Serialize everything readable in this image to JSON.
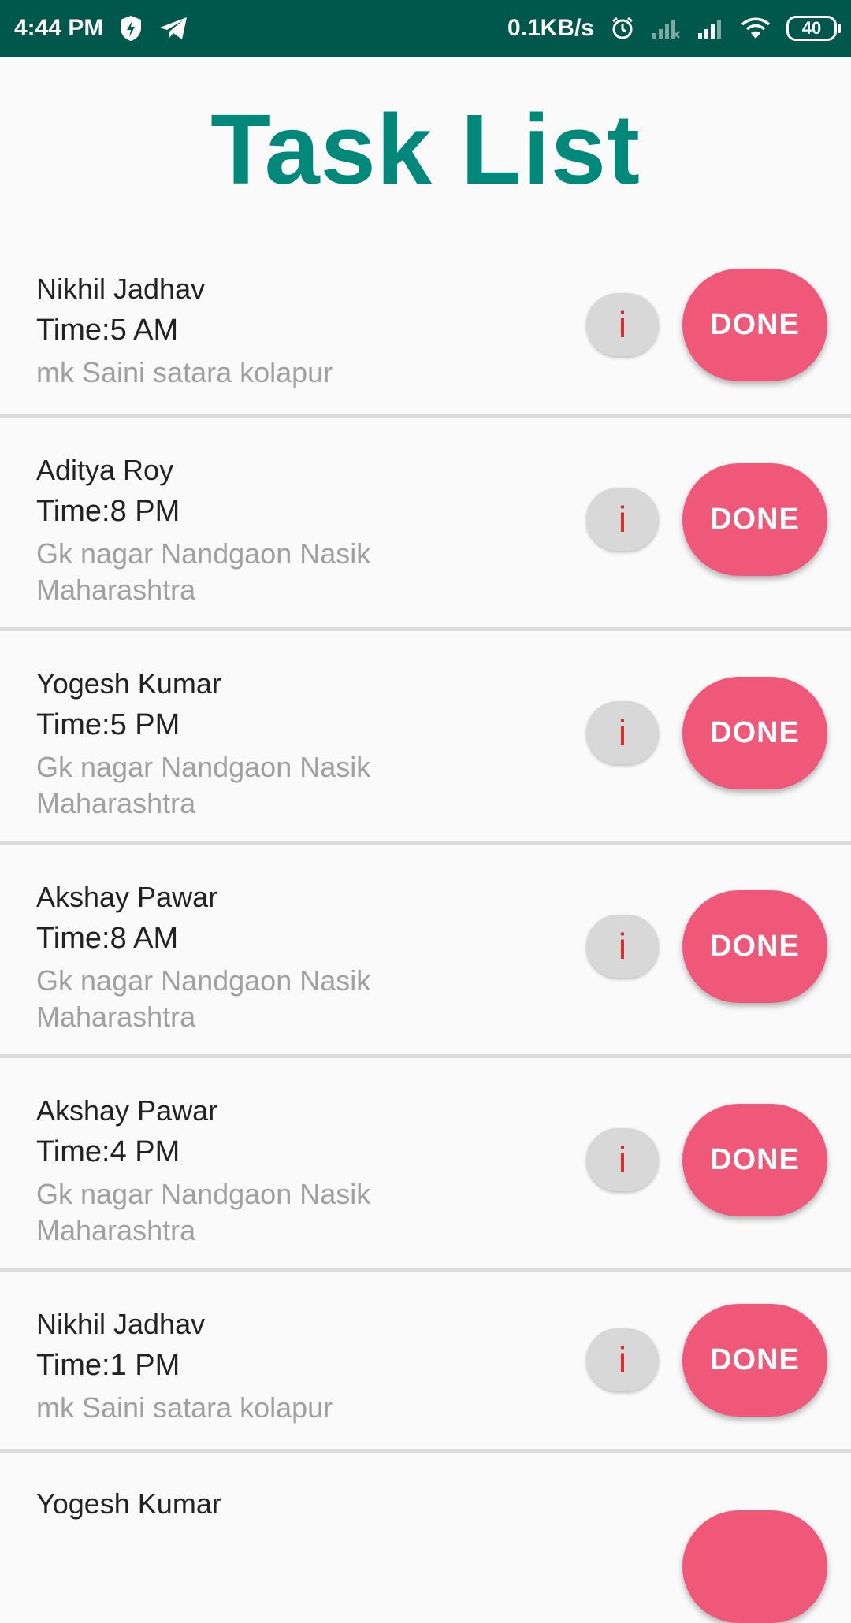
{
  "status_bar": {
    "time": "4:44 PM",
    "net_speed": "0.1KB/s",
    "battery": "40",
    "icons": [
      "shield-icon",
      "telegram-icon",
      "alarm-icon",
      "signal-icon",
      "signal-icon",
      "wifi-icon",
      "battery-icon"
    ]
  },
  "page": {
    "title": "Task List"
  },
  "colors": {
    "status_bar": "#00574b",
    "title": "#00897b",
    "done_button": "#ef5879",
    "info_glyph": "#d32f2f"
  },
  "tasks": [
    {
      "name": "Nikhil Jadhav",
      "time": "Time:5 AM",
      "address": "mk Saini satara kolapur",
      "info_label": "i",
      "done_label": "DONE"
    },
    {
      "name": "Aditya Roy",
      "time": "Time:8 PM",
      "address": "Gk nagar Nandgaon Nasik Maharashtra",
      "info_label": "i",
      "done_label": "DONE"
    },
    {
      "name": "Yogesh Kumar",
      "time": "Time:5 PM",
      "address": "Gk nagar Nandgaon Nasik Maharashtra",
      "info_label": "i",
      "done_label": "DONE"
    },
    {
      "name": "Akshay Pawar",
      "time": "Time:8 AM",
      "address": "Gk nagar Nandgaon Nasik Maharashtra",
      "info_label": "i",
      "done_label": "DONE"
    },
    {
      "name": "Akshay Pawar",
      "time": "Time:4 PM",
      "address": "Gk nagar Nandgaon Nasik Maharashtra",
      "info_label": "i",
      "done_label": "DONE"
    },
    {
      "name": "Nikhil Jadhav",
      "time": "Time:1 PM",
      "address": "mk Saini satara kolapur",
      "info_label": "i",
      "done_label": "DONE"
    },
    {
      "name": "Yogesh Kumar",
      "time": "",
      "address": "",
      "info_label": "",
      "done_label": ""
    }
  ]
}
